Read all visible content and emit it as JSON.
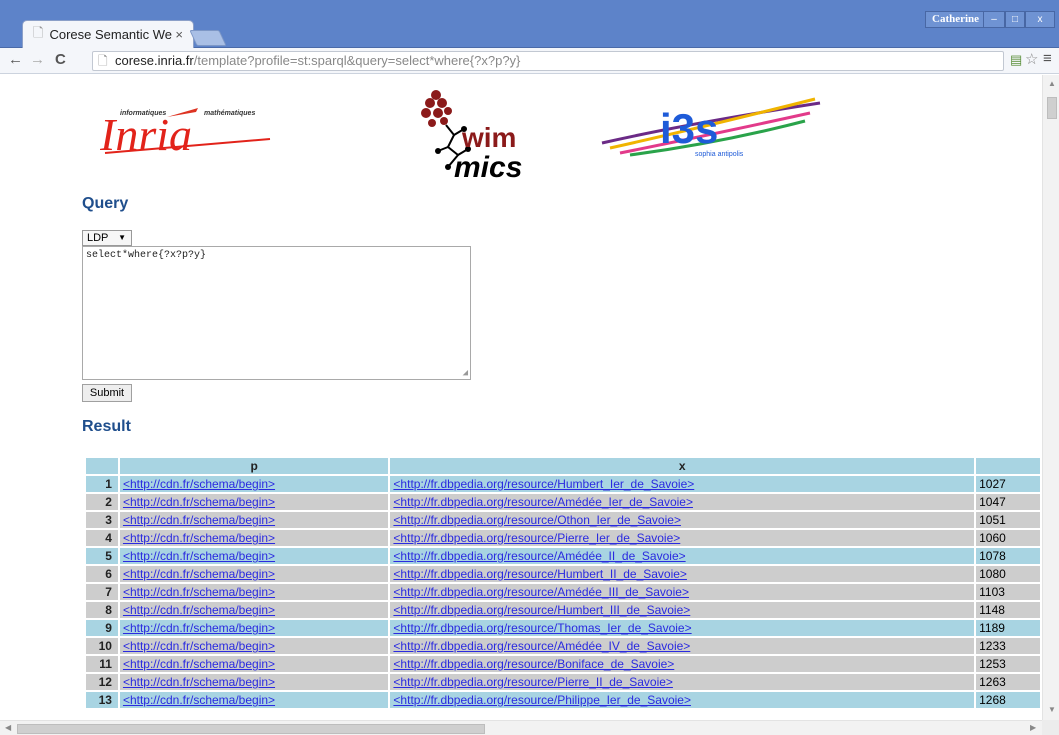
{
  "browser": {
    "tab_title": "Corese Semantic We",
    "tab_close": "×",
    "user_name": "Catherine",
    "win_min": "–",
    "win_max": "□",
    "win_close": "x",
    "url_host": "corese.inria.fr",
    "url_path": "/template?profile=st:sparql&query=select*where{?x?p?y}"
  },
  "logos": {
    "inria_sub_left": "informatiques",
    "inria_sub_right": "mathématiques",
    "inria_word": "Inria",
    "wimmics_top": "wim",
    "wimmics_bottom": "mics",
    "i3s_word": "i3s",
    "i3s_sub": "sophia antipolis"
  },
  "query": {
    "heading": "Query",
    "select_value": "LDP",
    "query_text": "select*where{?x?p?y}",
    "submit_label": "Submit"
  },
  "result": {
    "heading": "Result",
    "columns": [
      "",
      "p",
      "x",
      ""
    ],
    "rows": [
      {
        "n": "1",
        "p": "<http://cdn.fr/schema/begin>",
        "x": "<http://fr.dbpedia.org/resource/Humbert_Ier_de_Savoie>",
        "y": "1027"
      },
      {
        "n": "2",
        "p": "<http://cdn.fr/schema/begin>",
        "x": "<http://fr.dbpedia.org/resource/Amédée_Ier_de_Savoie>",
        "y": "1047"
      },
      {
        "n": "3",
        "p": "<http://cdn.fr/schema/begin>",
        "x": "<http://fr.dbpedia.org/resource/Othon_Ier_de_Savoie>",
        "y": "1051"
      },
      {
        "n": "4",
        "p": "<http://cdn.fr/schema/begin>",
        "x": "<http://fr.dbpedia.org/resource/Pierre_Ier_de_Savoie>",
        "y": "1060"
      },
      {
        "n": "5",
        "p": "<http://cdn.fr/schema/begin>",
        "x": "<http://fr.dbpedia.org/resource/Amédée_II_de_Savoie>",
        "y": "1078"
      },
      {
        "n": "6",
        "p": "<http://cdn.fr/schema/begin>",
        "x": "<http://fr.dbpedia.org/resource/Humbert_II_de_Savoie>",
        "y": "1080"
      },
      {
        "n": "7",
        "p": "<http://cdn.fr/schema/begin>",
        "x": "<http://fr.dbpedia.org/resource/Amédée_III_de_Savoie>",
        "y": "1103"
      },
      {
        "n": "8",
        "p": "<http://cdn.fr/schema/begin>",
        "x": "<http://fr.dbpedia.org/resource/Humbert_III_de_Savoie>",
        "y": "1148"
      },
      {
        "n": "9",
        "p": "<http://cdn.fr/schema/begin>",
        "x": "<http://fr.dbpedia.org/resource/Thomas_Ier_de_Savoie>",
        "y": "1189"
      },
      {
        "n": "10",
        "p": "<http://cdn.fr/schema/begin>",
        "x": "<http://fr.dbpedia.org/resource/Amédée_IV_de_Savoie>",
        "y": "1233"
      },
      {
        "n": "11",
        "p": "<http://cdn.fr/schema/begin>",
        "x": "<http://fr.dbpedia.org/resource/Boniface_de_Savoie>",
        "y": "1253"
      },
      {
        "n": "12",
        "p": "<http://cdn.fr/schema/begin>",
        "x": "<http://fr.dbpedia.org/resource/Pierre_II_de_Savoie>",
        "y": "1263"
      },
      {
        "n": "13",
        "p": "<http://cdn.fr/schema/begin>",
        "x": "<http://fr.dbpedia.org/resource/Philippe_Ier_de_Savoie>",
        "y": "1268"
      }
    ]
  },
  "colors": {
    "titlebar": "#5d83c9",
    "heading": "#1f4e8c",
    "row_odd": "#a8d4e2",
    "row_even": "#cdcdcd",
    "link": "#2a2ae0"
  },
  "icons": [
    "page-icon",
    "back-icon",
    "forward-icon",
    "reload-icon",
    "translate-icon",
    "star-icon",
    "menu-icon"
  ]
}
